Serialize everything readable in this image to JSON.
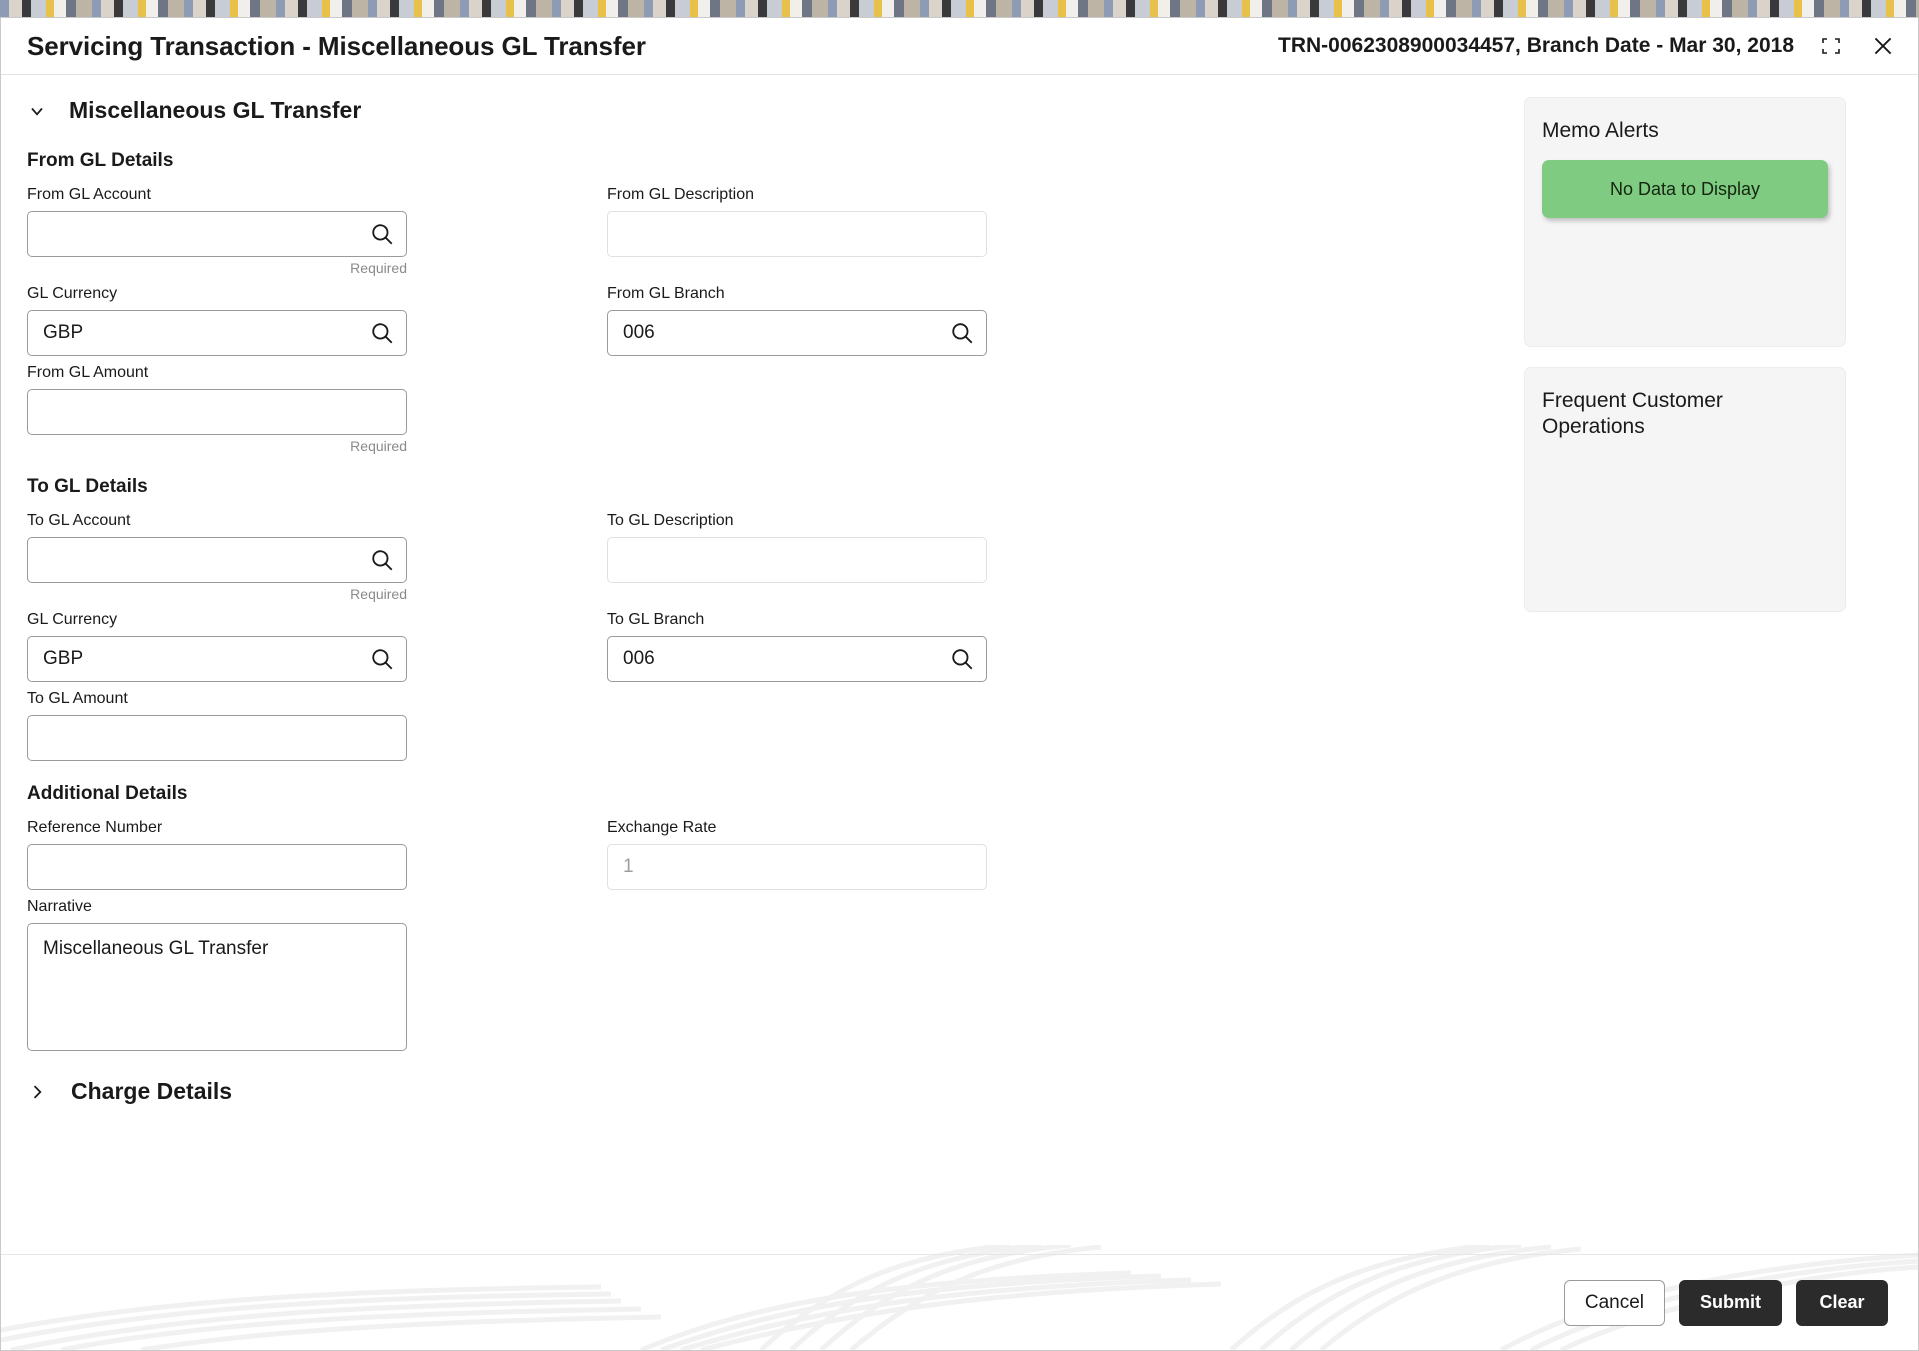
{
  "window": {
    "title": "Servicing Transaction - Miscellaneous GL Transfer",
    "transaction_ref": "TRN-0062308900034457, Branch Date - Mar 30, 2018",
    "minimize_icon": "collapse-corners-icon",
    "close_icon": "close-icon"
  },
  "accordion": {
    "title": "Miscellaneous GL Transfer",
    "chevron": "chevron-down-icon"
  },
  "from_gl": {
    "section_title": "From GL Details",
    "account": {
      "label": "From GL Account",
      "value": "",
      "hint": "Required",
      "icon": "search-icon"
    },
    "description": {
      "label": "From GL Description",
      "value": ""
    },
    "currency": {
      "label": "GL Currency",
      "value": "GBP",
      "icon": "search-icon"
    },
    "branch": {
      "label": "From GL Branch",
      "value": "006",
      "icon": "search-icon"
    },
    "amount": {
      "label": "From GL Amount",
      "value": "",
      "hint": "Required"
    }
  },
  "to_gl": {
    "section_title": "To GL Details",
    "account": {
      "label": "To GL Account",
      "value": "",
      "hint": "Required",
      "icon": "search-icon"
    },
    "description": {
      "label": "To GL Description",
      "value": ""
    },
    "currency": {
      "label": "GL Currency",
      "value": "GBP",
      "icon": "search-icon"
    },
    "branch": {
      "label": "To GL Branch",
      "value": "006",
      "icon": "search-icon"
    },
    "amount": {
      "label": "To GL Amount",
      "value": ""
    }
  },
  "additional": {
    "section_title": "Additional Details",
    "reference_number": {
      "label": "Reference Number",
      "value": ""
    },
    "exchange_rate": {
      "label": "Exchange Rate",
      "value": "",
      "placeholder": "1"
    },
    "narrative": {
      "label": "Narrative",
      "value": "Miscellaneous GL Transfer"
    }
  },
  "charge_details": {
    "title": "Charge Details",
    "chevron": "chevron-right-icon"
  },
  "memo_alerts": {
    "title": "Memo Alerts",
    "empty_message": "No Data to Display",
    "empty_color": "#7ecb81"
  },
  "frequent_customer_operations": {
    "title": "Frequent Customer Operations"
  },
  "footer": {
    "cancel": "Cancel",
    "submit": "Submit",
    "clear": "Clear"
  }
}
